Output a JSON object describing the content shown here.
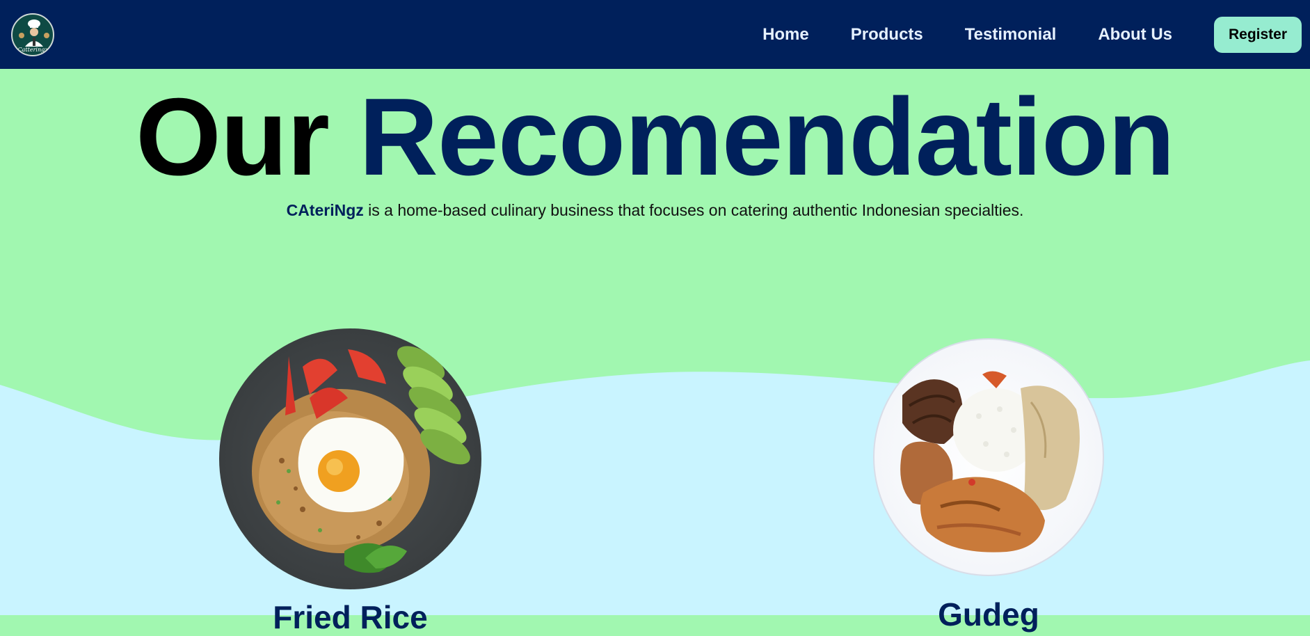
{
  "nav": {
    "logo_text": "Catteringz",
    "links": [
      "Home",
      "Products",
      "Testimonial",
      "About Us"
    ],
    "register_label": "Register"
  },
  "hero": {
    "title_word1": "Our",
    "title_word2": "Recomendation",
    "brand": "CAteriNgz",
    "subtitle_rest": " is a home-based culinary business that focuses on catering authentic Indonesian specialties."
  },
  "products": [
    {
      "name": "Fried Rice",
      "image": "fried-rice-plate-image"
    },
    {
      "name": "Gudeg",
      "image": "gudeg-plate-image"
    }
  ],
  "colors": {
    "navy": "#00205b",
    "mint_green": "#a1f7b0",
    "light_blue": "#c9f4ff",
    "register_bg": "#96ecd0"
  }
}
